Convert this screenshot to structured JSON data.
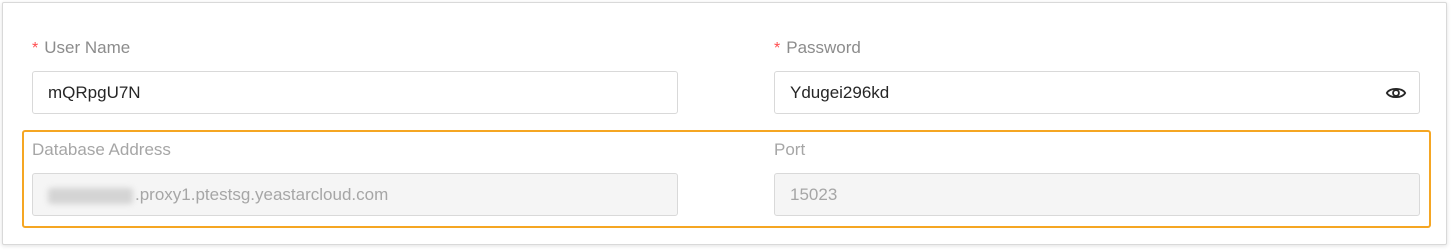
{
  "form": {
    "username": {
      "label": "User Name",
      "required_mark": "*",
      "value": "mQRpgU7N"
    },
    "password": {
      "label": "Password",
      "required_mark": "*",
      "value": "Ydugei296kd",
      "toggle_icon": "eye-icon"
    },
    "database_address": {
      "label": "Database Address",
      "value_prefix_blurred": "cxxxxxxxxx",
      "value_visible": ".proxy1.ptestsg.yeastarcloud.com"
    },
    "port": {
      "label": "Port",
      "value": "15023"
    }
  },
  "colors": {
    "required": "#ff4d4f",
    "highlight": "#f5a623",
    "disabled_bg": "#f5f5f5",
    "label": "#8c8c8c"
  }
}
